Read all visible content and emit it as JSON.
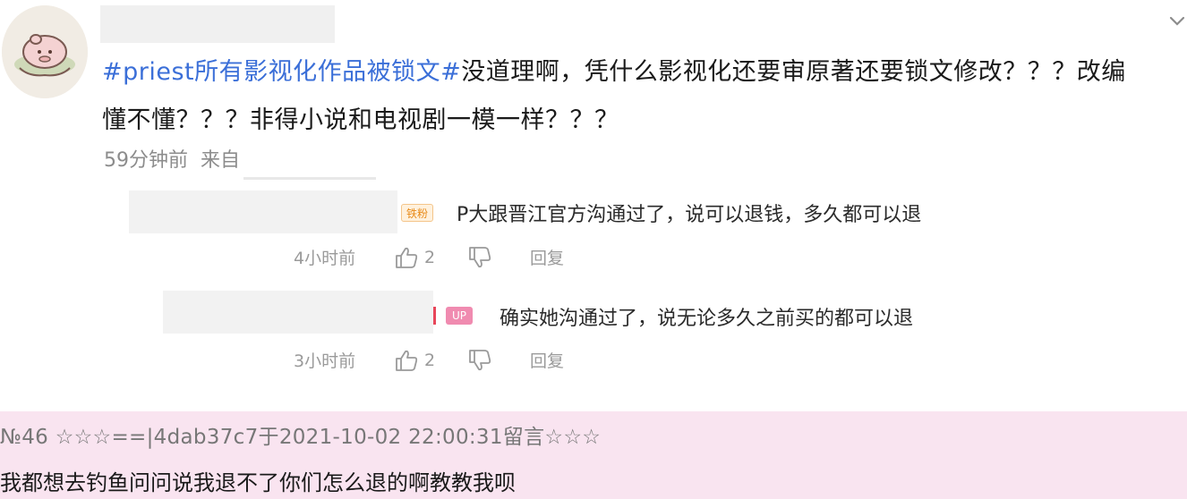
{
  "post": {
    "hashtag": "#priest所有影视化作品被锁文#",
    "text_line1": "没道理啊，凭什么影视化还要审原著还要锁文修改？？？改编",
    "text_line2": "懂不懂？？？非得小说和电视剧一模一样？？？",
    "time": "59分钟前",
    "source": "来自"
  },
  "replies": [
    {
      "badge": "铁粉",
      "text": "P大跟晋江官方沟通过了，说可以退钱，多久都可以退",
      "time": "4小时前",
      "likes": "2",
      "reply_label": "回复"
    },
    {
      "badge": "UP",
      "text": "确实她沟通过了，说无论多久之前买的都可以退",
      "time": "3小时前",
      "likes": "2",
      "reply_label": "回复"
    }
  ],
  "guestbook": {
    "header": "№46 ☆☆☆==|4dab37c7于2021-10-02 22:00:31留言☆☆☆",
    "body": "我都想去钓鱼问问说我退不了你们怎么退的啊教教我呗"
  },
  "colors": {
    "hashtag": "#3b6fd8",
    "pink_band": "#f9e4f0",
    "badge_up": "#f08bb0"
  }
}
